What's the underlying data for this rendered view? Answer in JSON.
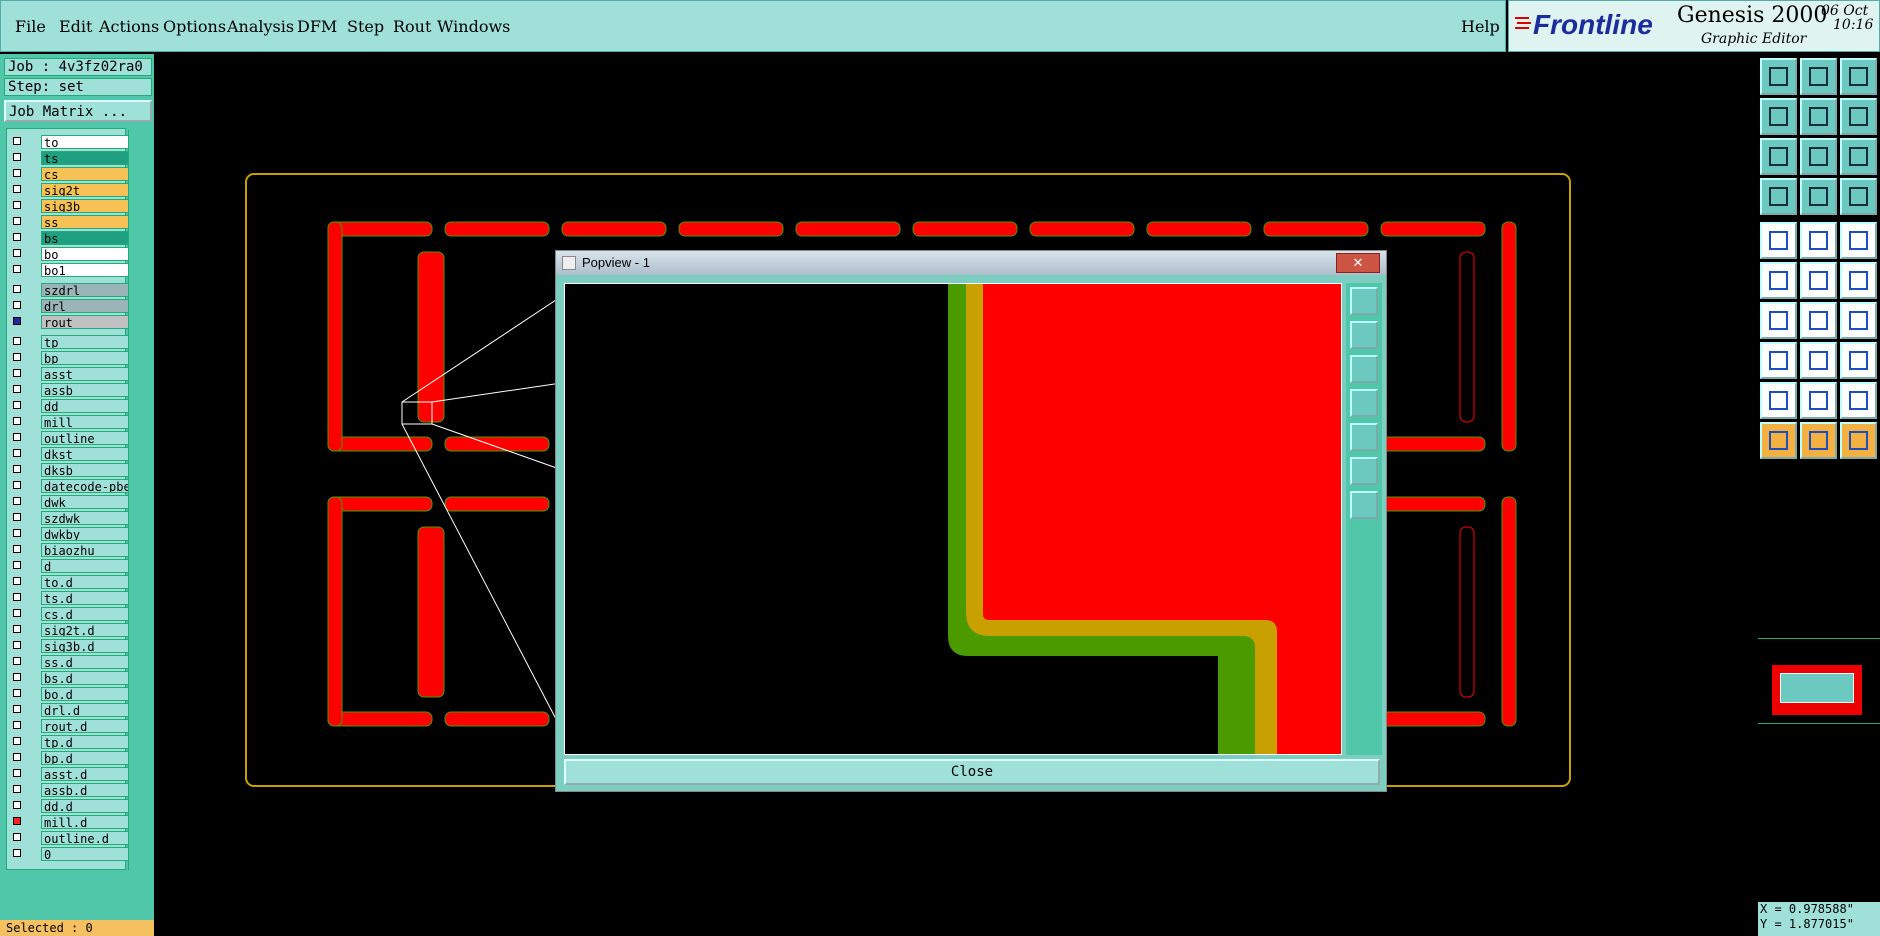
{
  "menu": [
    "File",
    "Edit",
    "Actions",
    "Options",
    "Analysis",
    "DFM",
    "Step",
    "Rout",
    "Windows"
  ],
  "help_label": "Help",
  "brand": {
    "logo": "Frontline",
    "product": "Genesis 2000",
    "subtitle": "Graphic Editor",
    "date": "06 Oct",
    "time": "10:16"
  },
  "job": {
    "label": "Job : 4v3fz02ra0",
    "step": "Step: set",
    "matrix_button": "Job Matrix ..."
  },
  "layers_board": [
    {
      "name": "to",
      "color": "#ffffff"
    },
    {
      "name": "ts",
      "color": "#1fa080"
    },
    {
      "name": "cs",
      "color": "#f7c255"
    },
    {
      "name": "sig2t",
      "color": "#f7c255"
    },
    {
      "name": "sig3b",
      "color": "#f7c255"
    },
    {
      "name": "ss",
      "color": "#f7c255"
    },
    {
      "name": "bs",
      "color": "#1fa080"
    },
    {
      "name": "bo",
      "color": "#ffffff"
    },
    {
      "name": "bo1",
      "color": "#ffffff"
    }
  ],
  "layers_drill": [
    {
      "name": "szdrl",
      "color": "#9ab4b8"
    },
    {
      "name": "drl",
      "color": "#9ab4b8"
    },
    {
      "name": "rout",
      "color": "#c0c0c0"
    }
  ],
  "layers_misc": [
    "tp",
    "bp",
    "asst",
    "assb",
    "dd",
    "mill",
    "outline",
    "dkst",
    "dksb",
    "datecode-pbe",
    "dwk",
    "szdwk",
    "dwkby",
    "biaozhu",
    "d",
    "to.d",
    "ts.d",
    "cs.d",
    "sig2t.d",
    "sig3b.d",
    "ss.d",
    "bs.d",
    "bo.d",
    "drl.d",
    "rout.d",
    "tp.d",
    "bp.d",
    "asst.d",
    "assb.d",
    "dd.d",
    "mill.d",
    "outline.d",
    "0"
  ],
  "status": {
    "selected": "Selected : 0"
  },
  "coords": {
    "x": "X = 0.978588\"",
    "y": "Y = 1.877015\""
  },
  "popup": {
    "title": "Popview - 1",
    "close_label": "Close",
    "close_x": "✕"
  },
  "colors": {
    "accent": "#4fc7a8",
    "panel": "#9fe0d8",
    "feature": "#ff0000",
    "profile": "#d8a000",
    "green": "#4a9a00"
  },
  "toolbar_icons": [
    "zoom-in-icon",
    "zoom-out-icon",
    "home-icon",
    "pan-left-icon",
    "pan-right-icon",
    "undo-view-icon",
    "fit-icon",
    "center-icon",
    "scale-icon",
    "measure-icon",
    "grid-icon",
    "snap-icon",
    "select-icon",
    "draw-icon",
    "ruler-icon",
    "connect-icon",
    "cross-icon",
    "node-icon",
    "line-icon",
    "slope-icon",
    "arc-icon",
    "pad-icon",
    "dash-icon",
    "dimension-icon",
    "triangle-icon",
    "arrow-up-icon",
    "angle-icon",
    "pointer-icon",
    "pointer-orange-icon",
    "pointer-outline-icon"
  ]
}
